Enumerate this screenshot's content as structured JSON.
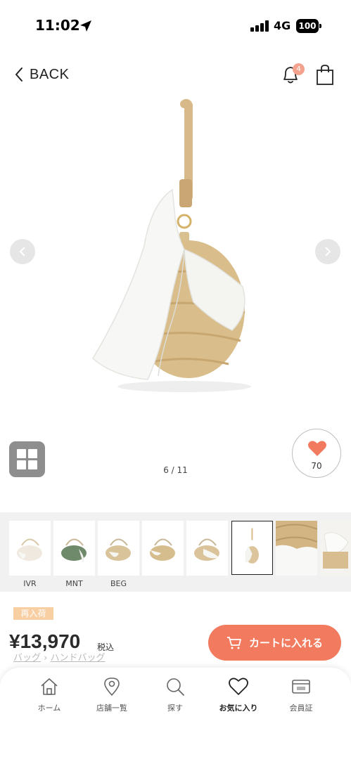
{
  "status_bar": {
    "time": "11:02",
    "network": "4G",
    "battery": "100"
  },
  "header": {
    "back_label": "BACK",
    "notification_count": "4"
  },
  "gallery": {
    "counter": "6 / 11"
  },
  "favorite": {
    "count": "70"
  },
  "color_swatches": [
    {
      "label": "IVR"
    },
    {
      "label": "MNT"
    },
    {
      "label": "BEG"
    },
    {
      "label": ""
    },
    {
      "label": ""
    },
    {
      "label": ""
    },
    {
      "label": ""
    },
    {
      "label": ""
    }
  ],
  "product": {
    "badge": "再入荷",
    "price": "¥13,970",
    "tax_label": "税込",
    "breadcrumbs": [
      "バッグ",
      "ハンドバッグ"
    ],
    "cart_label": "カートに入れる"
  },
  "tabbar": {
    "items": [
      {
        "label": "ホーム",
        "icon": "home-icon"
      },
      {
        "label": "店舗一覧",
        "icon": "location-pin-icon"
      },
      {
        "label": "探す",
        "icon": "search-icon"
      },
      {
        "label": "お気に入り",
        "icon": "heart-icon"
      },
      {
        "label": "会員証",
        "icon": "member-card-icon"
      }
    ]
  },
  "colors": {
    "accent": "#f27a5e",
    "heart": "#f27a5e",
    "badge_bg": "#f7cfa3"
  }
}
